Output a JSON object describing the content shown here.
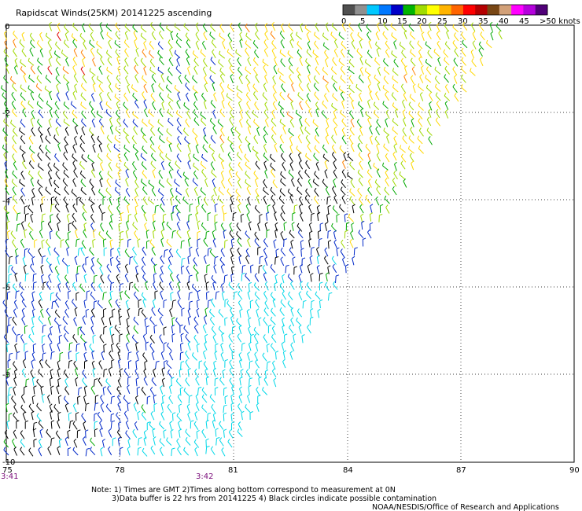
{
  "header": {
    "title": "Rapidscat Winds(25KM) 20141225 ascending"
  },
  "legend": {
    "labels": [
      "0",
      "5",
      "10",
      "15",
      "20",
      "25",
      "30",
      "35",
      "40",
      "45",
      ">50 knots"
    ],
    "colors": [
      "#505050",
      "#909090",
      "#00c8ff",
      "#0078ff",
      "#0000c8",
      "#00b400",
      "#a0dc00",
      "#ffff00",
      "#ffb400",
      "#ff6400",
      "#ff0000",
      "#b40000",
      "#784614",
      "#d2a078",
      "#ff00ff",
      "#b400dc",
      "#500078"
    ]
  },
  "axes": {
    "lat_labels": [
      "0",
      "-2",
      "-4",
      "-6",
      "-8",
      "-10"
    ],
    "lon_labels": [
      "75",
      "78",
      "81",
      "84",
      "87",
      "90"
    ]
  },
  "times": {
    "left": "3:41",
    "center": "3:42"
  },
  "notes": {
    "line1": "Note: 1) Times are GMT 2)Times along bottom correspond to measurement at 0N",
    "line2": "3)Data buffer is 22 hrs from 20141225 4) Black circles indicate possible contamination",
    "line3": "NOAA/NESDIS/Office of Research and Applications"
  },
  "swath": {
    "color_black": "#000000",
    "color_cyan": "#00d8e8",
    "color_blue": "#0028c8",
    "color_green": "#00a800",
    "color_lime": "#a0d800",
    "color_yellow": "#ffd800",
    "color_orange": "#ff8000",
    "color_red": "#e00000"
  }
}
